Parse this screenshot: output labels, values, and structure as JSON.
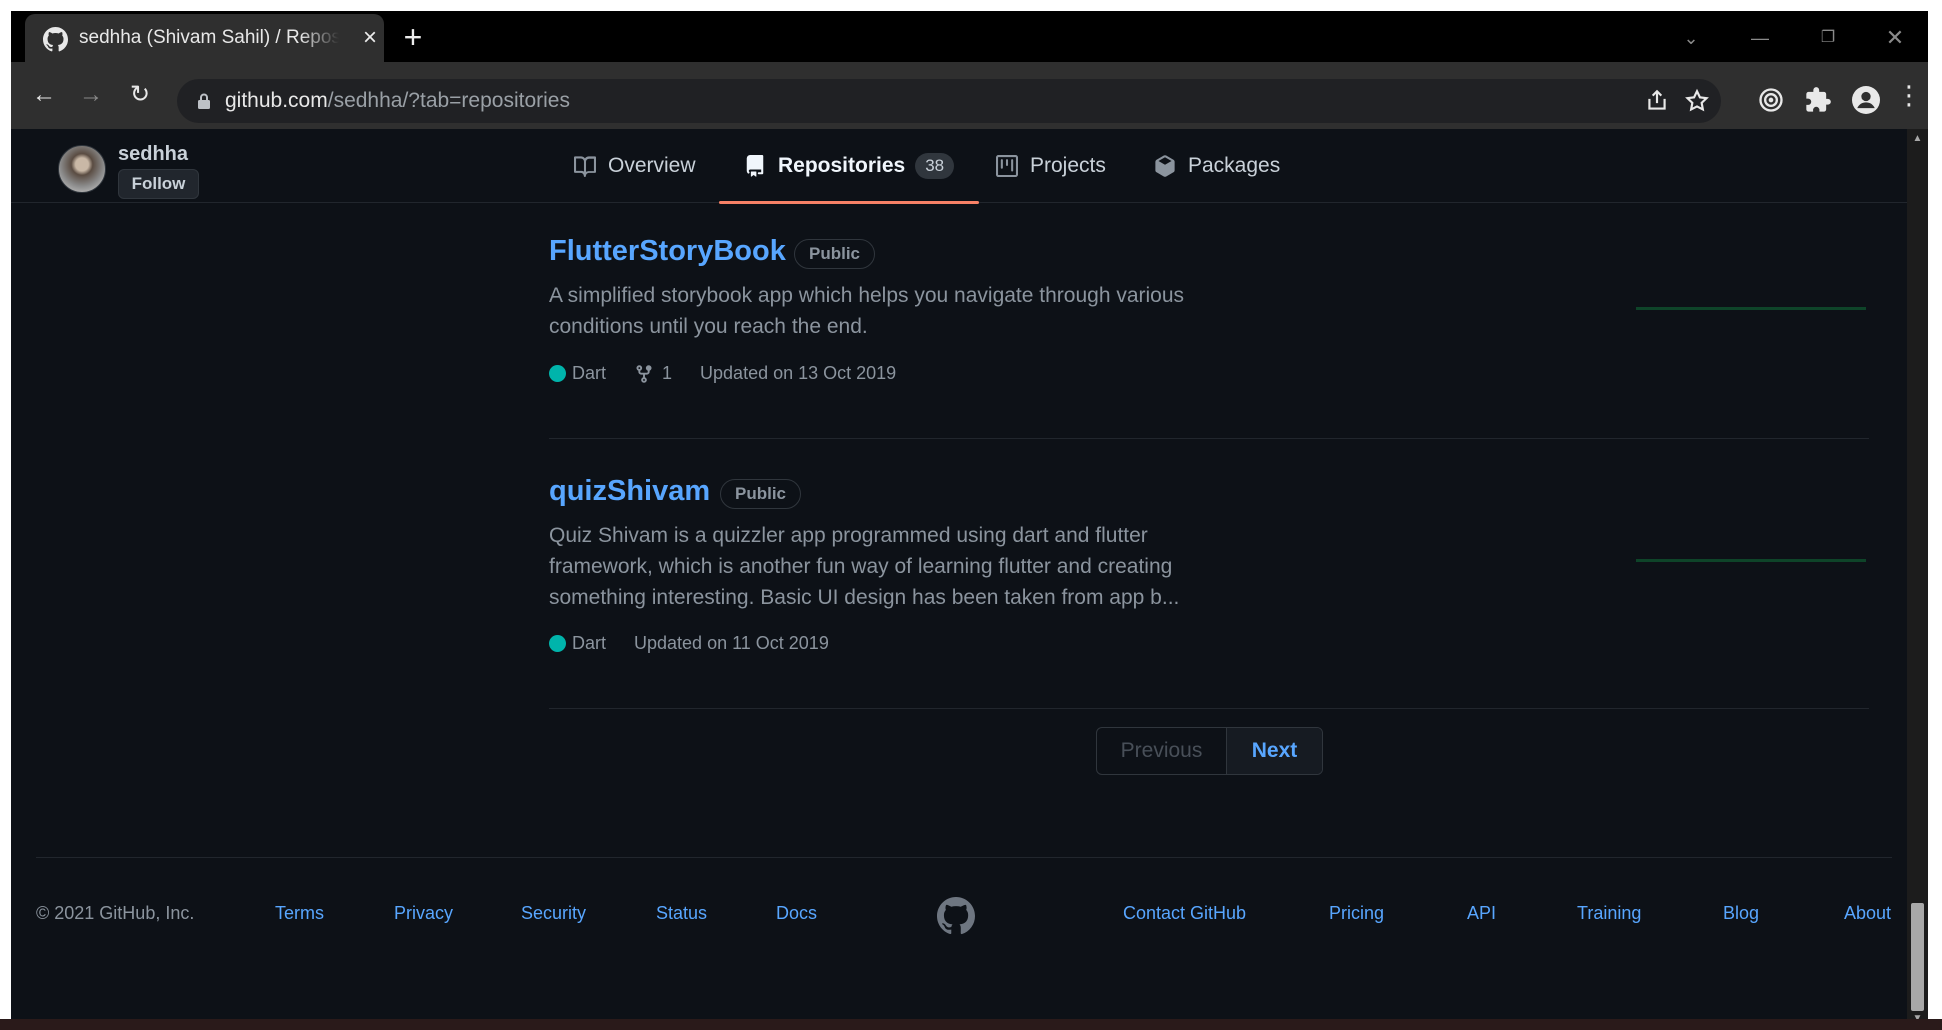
{
  "browser": {
    "tab_title": "sedhha (Shivam Sahil) / Repositories",
    "new_tab": "+",
    "url_host": "github.com",
    "url_path": "/sedhha/?tab=repositories"
  },
  "profile": {
    "username": "sedhha",
    "follow_label": "Follow"
  },
  "nav": {
    "tabs": [
      {
        "label": "Overview",
        "icon": "book-icon"
      },
      {
        "label": "Repositories",
        "icon": "repo-icon",
        "count": "38",
        "active": true
      },
      {
        "label": "Projects",
        "icon": "project-icon"
      },
      {
        "label": "Packages",
        "icon": "package-icon"
      }
    ]
  },
  "repos": [
    {
      "name": "FlutterStoryBook",
      "visibility": "Public",
      "description_lines": [
        "A simplified storybook app which helps you navigate through various",
        "conditions until you reach the end."
      ],
      "language": "Dart",
      "forks": "1",
      "updated": "Updated on 13 Oct 2019"
    },
    {
      "name": "quizShivam",
      "visibility": "Public",
      "description_lines": [
        "Quiz Shivam is a quizzler app programmed using dart and flutter",
        "framework, which is another fun way of learning flutter and creating",
        "something interesting. Basic UI design has been taken from app b..."
      ],
      "language": "Dart",
      "updated": "Updated on 11 Oct 2019"
    }
  ],
  "pagination": {
    "previous": "Previous",
    "next": "Next"
  },
  "footer": {
    "copyright": "© 2021 GitHub, Inc.",
    "left_links": [
      "Terms",
      "Privacy",
      "Security",
      "Status",
      "Docs"
    ],
    "right_links": [
      "Contact GitHub",
      "Pricing",
      "API",
      "Training",
      "Blog",
      "About"
    ]
  },
  "colors": {
    "page_bg": "#0d1117",
    "link": "#58a6ff",
    "dart": "#00b4ab",
    "active_tab_underline": "#f78166"
  }
}
